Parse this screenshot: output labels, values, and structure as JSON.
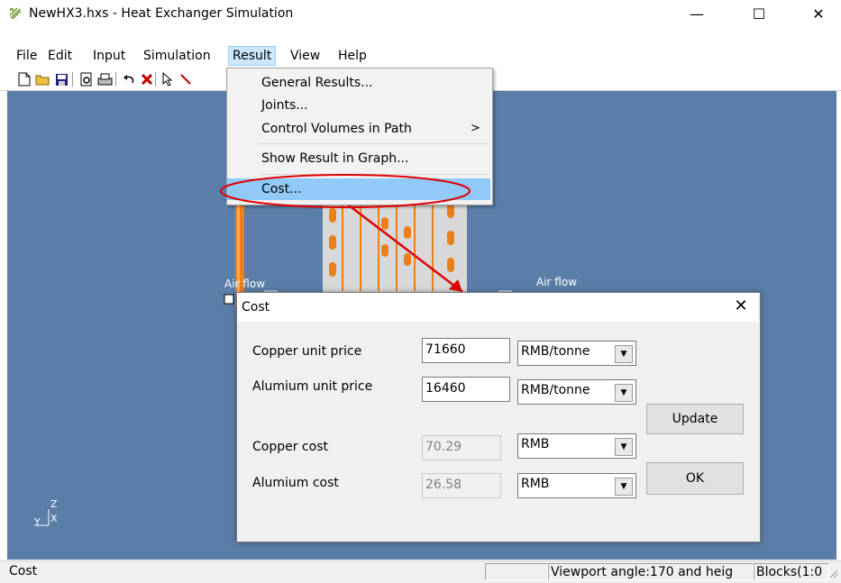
{
  "window": {
    "title": "NewHX3.hxs - Heat Exchanger Simulation",
    "min_glyph": "—",
    "max_glyph": "☐",
    "close_glyph": "✕"
  },
  "menu": [
    "File",
    "Edit",
    "Input",
    "Simulation",
    "Result",
    "View",
    "Help"
  ],
  "result_menu": {
    "items": [
      "General Results...",
      "Joints...",
      "Control Volumes in Path",
      "Show Result in Graph...",
      "Cost..."
    ],
    "submenu_arrow": ">"
  },
  "viewport": {
    "airflow_left": "Air flow",
    "airflow_right": "Air flow",
    "axis_z": "Z",
    "axis_y": "Y",
    "axis_x": "X"
  },
  "cost_dialog": {
    "title": "Cost",
    "close_glyph": "✕",
    "copper_unit_price_label": "Copper unit price",
    "copper_unit_price": "71660",
    "copper_unit": "RMB/tonne",
    "alumium_unit_price_label": "Alumium unit price",
    "alumium_unit_price": "16460",
    "alumium_unit": "RMB/tonne",
    "copper_cost_label": "Copper cost",
    "copper_cost": "70.29",
    "copper_cost_unit": "RMB",
    "alumium_cost_label": "Alumium cost",
    "alumium_cost": "26.58",
    "alumium_cost_unit": "RMB",
    "update_label": "Update",
    "ok_label": "OK"
  },
  "statusbar": {
    "left": "Cost",
    "viewport_info": "Viewport angle:170 and heig",
    "blocks": "Blocks(1:0"
  },
  "colors": {
    "viewport_bg": "#5a7ea8",
    "highlight": "#91c9f7",
    "annotation": "#e00000",
    "tube": "#e8801c"
  }
}
